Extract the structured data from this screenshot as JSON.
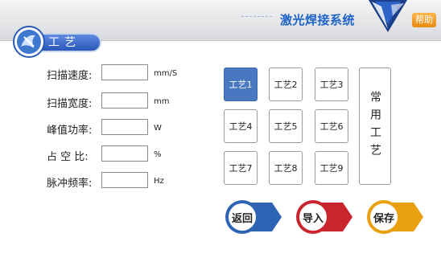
{
  "header": {
    "title": "激光焊接系统",
    "help_label": "帮助"
  },
  "section": {
    "title": "工艺"
  },
  "params": [
    {
      "label": "扫描速度:",
      "value": "",
      "unit": "mm/S"
    },
    {
      "label": "扫描宽度:",
      "value": "",
      "unit": "mm"
    },
    {
      "label": "峰值功率:",
      "value": "",
      "unit": "W"
    },
    {
      "label": "占 空 比:",
      "value": "",
      "unit": "%"
    },
    {
      "label": "脉冲频率:",
      "value": "",
      "unit": "Hz"
    }
  ],
  "processes": [
    "工艺1",
    "工艺2",
    "工艺3",
    "工艺4",
    "工艺5",
    "工艺6",
    "工艺7",
    "工艺8",
    "工艺9"
  ],
  "active_process": "工艺1",
  "common_label": "常用工艺",
  "actions": {
    "back": "返回",
    "import": "导入",
    "save": "保存"
  },
  "colors": {
    "accent": "#4a78c0",
    "back": "#2f63b4",
    "import": "#c8252f",
    "save": "#e8a010",
    "help": "#f29a1c"
  }
}
